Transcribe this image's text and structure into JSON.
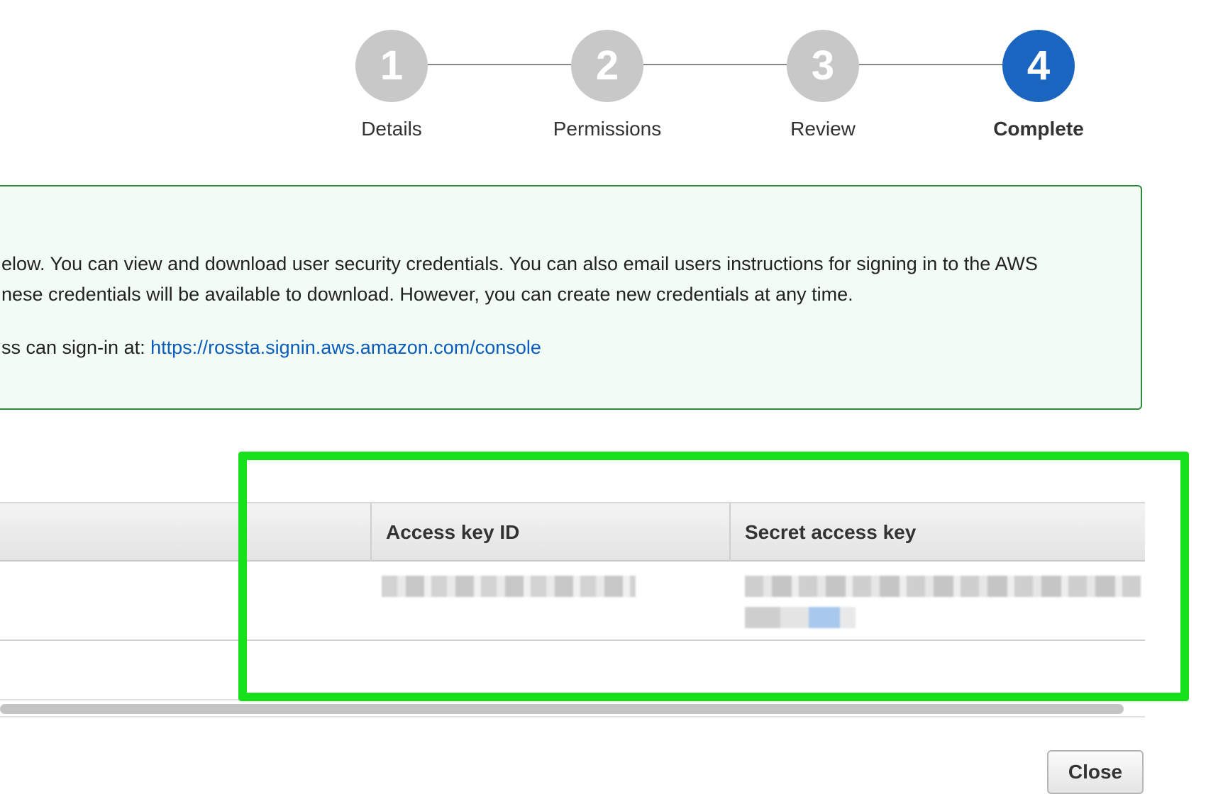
{
  "wizard": {
    "steps": [
      {
        "number": "1",
        "label": "Details"
      },
      {
        "number": "2",
        "label": "Permissions"
      },
      {
        "number": "3",
        "label": "Review"
      },
      {
        "number": "4",
        "label": "Complete",
        "active": true
      }
    ],
    "inactive_color": "#c8c8c8",
    "active_color": "#1a65bf"
  },
  "success": {
    "line1": "elow. You can view and download user security credentials. You can also email users instructions for signing in to the AWS",
    "line2": "nese credentials will be available to download. However, you can create new credentials at any time.",
    "signin_prefix": "ss can sign-in at: ",
    "signin_link": "https://rossta.signin.aws.amazon.com/console",
    "border_color": "#2e8b3a"
  },
  "table": {
    "columns": [
      "Access key ID",
      "Secret access key"
    ]
  },
  "highlight_color": "#16e11b",
  "close_label": "Close"
}
